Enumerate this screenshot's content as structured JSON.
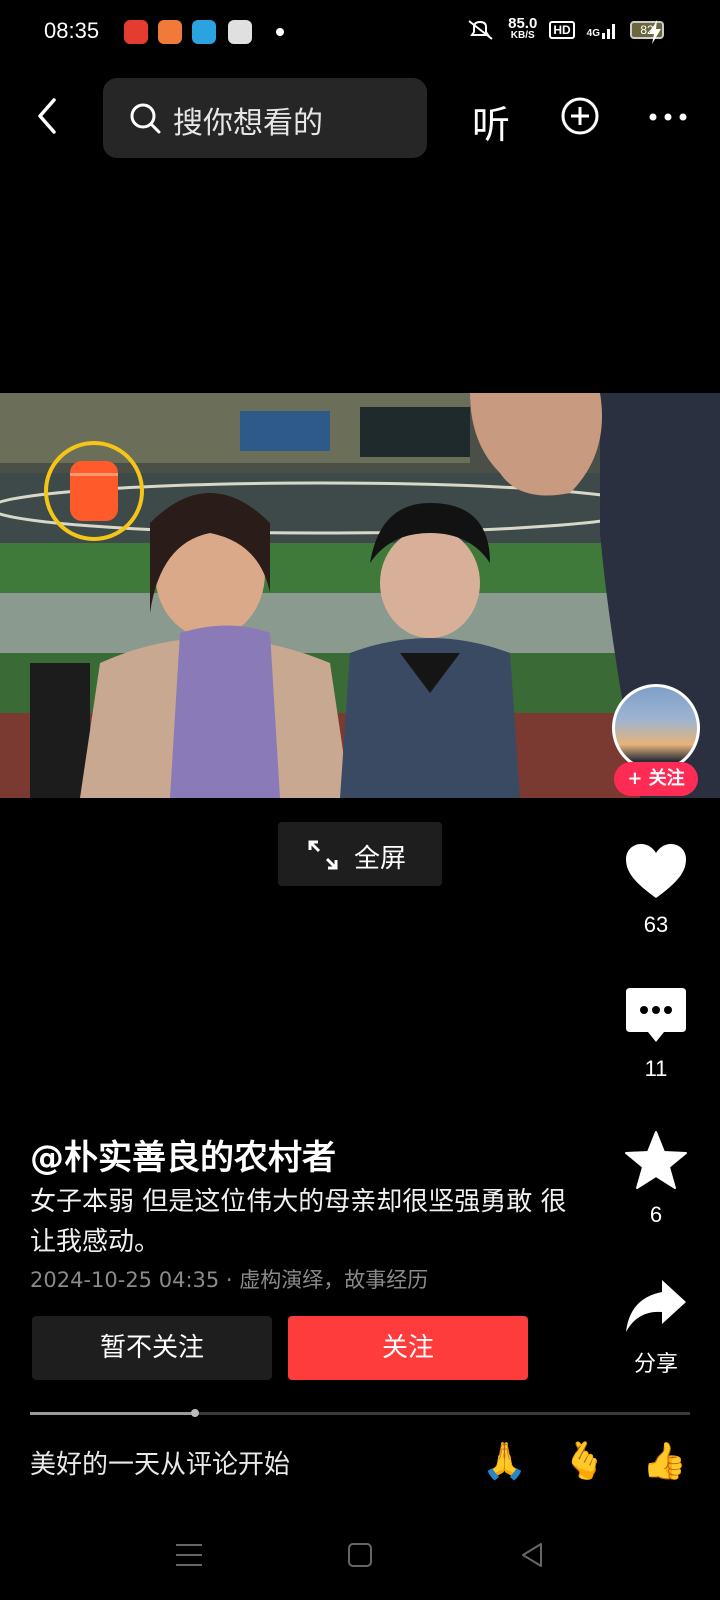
{
  "status_bar": {
    "time": "08:35",
    "speed_value": "85.0",
    "speed_unit": "KB/S",
    "hd": "HD",
    "network": "4G",
    "battery": "82"
  },
  "top_bar": {
    "search_placeholder": "搜你想看的",
    "listen_label": "听"
  },
  "video": {
    "fullscreen_label": "全屏",
    "follow_badge": "+ 关注"
  },
  "actions": {
    "likes": "63",
    "comments": "11",
    "favorites": "6",
    "share_label": "分享"
  },
  "post": {
    "author": "@朴实善良的农村者",
    "description": "女子本弱 但是这位伟大的母亲却很坚强勇敢 很让我感动。",
    "meta": "2024-10-25 04:35 · 虚构演绎，故事经历"
  },
  "buttons": {
    "not_follow": "暂不关注",
    "follow": "关注"
  },
  "playback": {
    "progress": 0.25
  },
  "comment_bar": {
    "prompt": "美好的一天从评论开始",
    "emojis": [
      "🙏",
      "🫰",
      "👍"
    ]
  },
  "colors": {
    "accent_red": "#fe3c3c",
    "follow_pink": "#fe2c55"
  }
}
